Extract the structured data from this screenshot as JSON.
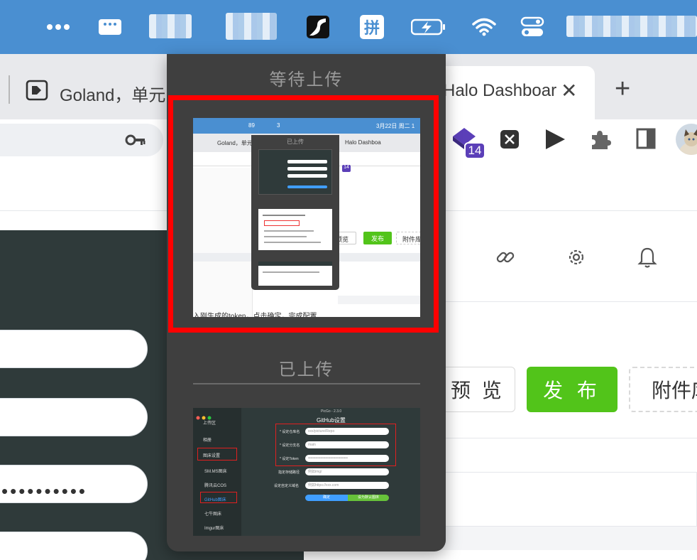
{
  "menubar": {
    "ime_label": "拼",
    "icons": [
      "more-icon",
      "message-icon",
      "app-icon",
      "ime-icon",
      "battery-charging-icon",
      "wifi-icon",
      "control-center-icon"
    ]
  },
  "browser": {
    "tabs": [
      {
        "title": "Goland，单元"
      },
      {
        "title": "Halo Dashboar"
      }
    ],
    "new_tab_label": "+",
    "close_label": "✕",
    "extension_badge": "14"
  },
  "editor": {
    "preview_label": "预 览",
    "publish_label": "发 布",
    "attachments_label": "附件库",
    "password_dots": "••••••••••"
  },
  "upload_popup": {
    "waiting_title": "等待上传",
    "uploaded_title": "已上传",
    "waiting_thumb": {
      "menubar_items": [
        "89",
        "3"
      ],
      "datetime": "3月22日 周二 1",
      "tab_left": "Goland，单元",
      "tab_right": "Halo Dashboa",
      "inner_title": "已上传",
      "badge": "14",
      "preview_label": "预览",
      "publish_label": "发布",
      "attachments_label": "附件库",
      "caption": "入刚生成的token，点击确定，完成配置"
    },
    "uploaded_thumb": {
      "app_title": "PicGo - 2.3.0",
      "settings_title": "GitHub设置",
      "sidebar": [
        "上传区",
        "相册",
        "图床设置",
        "SM.MS图床",
        "腾讯云COS",
        "GitHub图床",
        "七牛图床",
        "Imgur图床"
      ],
      "fields": [
        {
          "label": "* 设定仓库名",
          "value": "xxx/picture/Repo"
        },
        {
          "label": "* 设定分支名",
          "value": "main"
        },
        {
          "label": "* 设定Token",
          "value": "••••••••••••••••••••••••••••••••"
        },
        {
          "label": "指定存储路径",
          "value": "例如img/"
        },
        {
          "label": "设定自定义域名",
          "value": "例如https://xxx.com"
        }
      ],
      "confirm_label": "确定",
      "default_label": "设为默认图床"
    }
  },
  "colors": {
    "menubar": "#4a8fd1",
    "popup_bg": "#3f3f3f",
    "highlight": "#ff0000",
    "publish_green": "#52c41a",
    "picgo_bg": "#2f3a3a",
    "picgo_accent": "#409eff"
  }
}
